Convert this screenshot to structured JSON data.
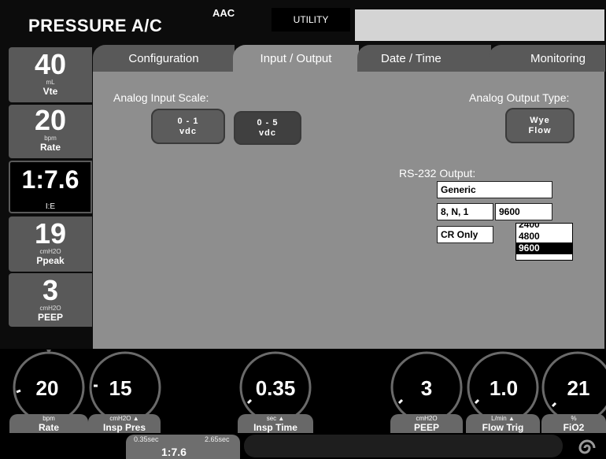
{
  "header": {
    "title": "PRESSURE A/C",
    "mode": "AAC",
    "utility_label": "UTILITY"
  },
  "left_params": [
    {
      "value": "40",
      "unit": "mL",
      "name": "Vte"
    },
    {
      "value": "20",
      "unit": "bpm",
      "name": "Rate"
    },
    {
      "value": "1:7.6",
      "unit": "",
      "name": "I:E"
    },
    {
      "value": "19",
      "unit": "cmH2O",
      "name": "Ppeak"
    },
    {
      "value": "3",
      "unit": "cmH2O",
      "name": "PEEP"
    }
  ],
  "tabs": [
    {
      "label": "Configuration",
      "active": false
    },
    {
      "label": "Input / Output",
      "active": true
    },
    {
      "label": "Date / Time",
      "active": false
    },
    {
      "label": "Monitoring",
      "active": false
    }
  ],
  "io": {
    "analog_input_label": "Analog Input Scale:",
    "analog_input_options": [
      {
        "line1": "0 - 1",
        "line2": "vdc"
      },
      {
        "line1": "0 - 5",
        "line2": "vdc"
      }
    ],
    "analog_output_label": "Analog Output Type:",
    "analog_output_value": {
      "line1": "Wye",
      "line2": "Flow"
    },
    "rs232_label": "RS-232 Output:",
    "protocol": "Generic",
    "framing": "8, N, 1",
    "baud": "9600",
    "line_end": "CR Only",
    "baud_options": [
      "2400",
      "4800",
      "9600"
    ]
  },
  "dials": [
    {
      "value": "20",
      "unit": "bpm",
      "name": "Rate",
      "arrow": false
    },
    {
      "value": "15",
      "unit": "cmH2O",
      "name": "Insp Pres",
      "arrow": true
    },
    {
      "value": "0.35",
      "unit": "sec",
      "name": "Insp Time",
      "arrow": true
    },
    {
      "value": "3",
      "unit": "cmH2O",
      "name": "PEEP",
      "arrow": false
    },
    {
      "value": "1.0",
      "unit": "L/min",
      "name": "Flow Trig",
      "arrow": true
    },
    {
      "value": "21",
      "unit": "%",
      "name": "FiO2",
      "arrow": false
    }
  ],
  "ie_indicator": {
    "min": "0.35sec",
    "max": "2.65sec",
    "ratio": "1:7.6"
  },
  "icons": {
    "dial_arrow": "arrow-up",
    "logo": "spiral-logo"
  }
}
